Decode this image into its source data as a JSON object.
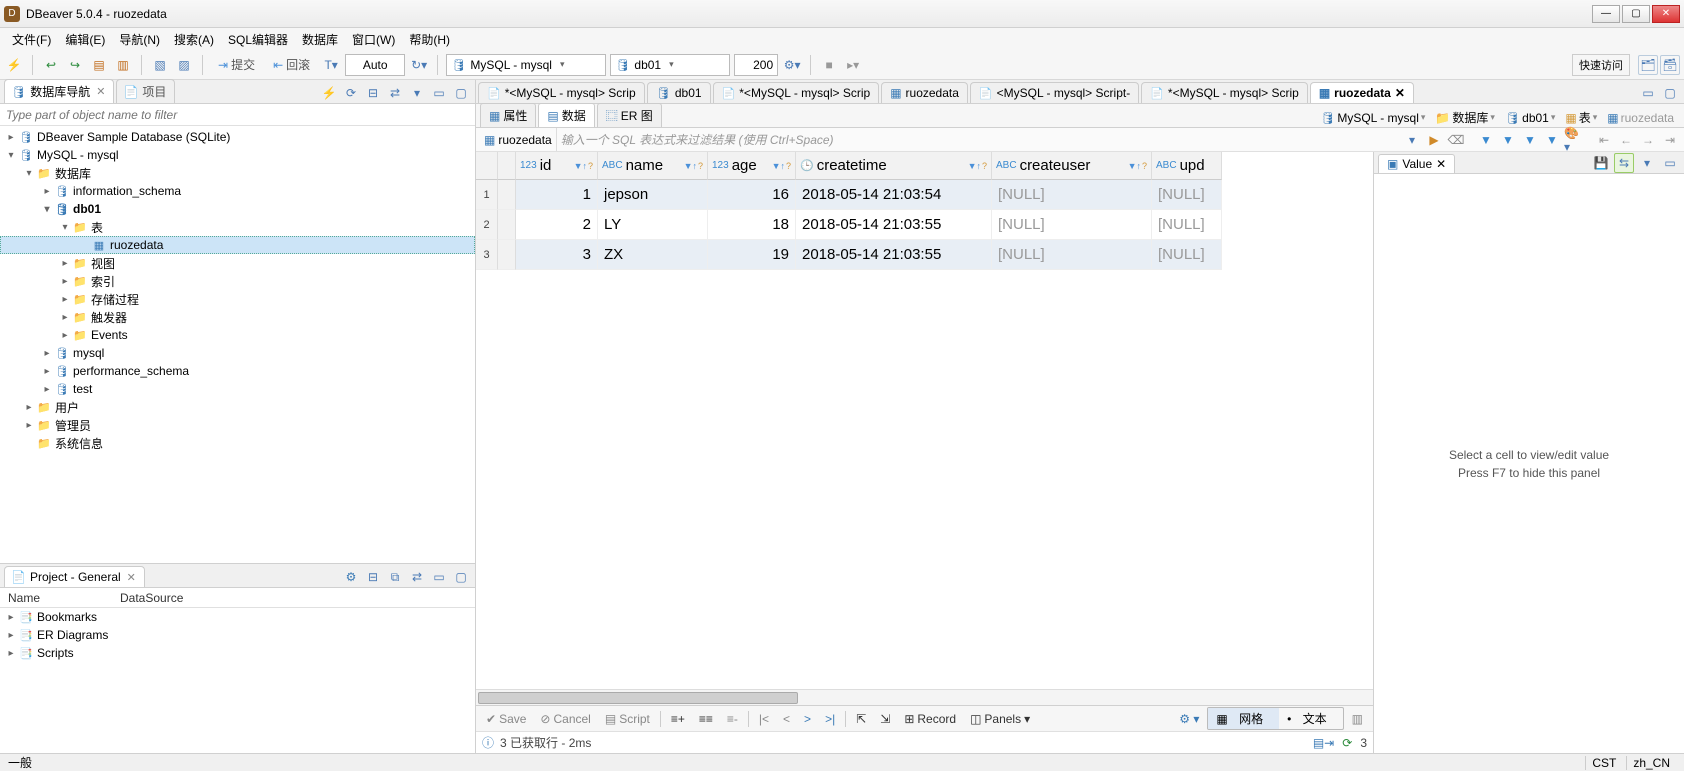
{
  "title": "DBeaver 5.0.4 - ruozedata",
  "menu": [
    "文件(F)",
    "编辑(E)",
    "导航(N)",
    "搜索(A)",
    "SQL编辑器",
    "数据库",
    "窗口(W)",
    "帮助(H)"
  ],
  "toolbar": {
    "commit": "提交",
    "rollback": "回滚",
    "auto": "Auto",
    "connection": "MySQL - mysql",
    "database": "db01",
    "limit": "200",
    "quick_access": "快速访问"
  },
  "nav_panel": {
    "tabs": [
      "数据库导航",
      "项目"
    ],
    "filter_placeholder": "Type part of object name to filter",
    "tree": {
      "root1": "DBeaver Sample Database (SQLite)",
      "root2": "MySQL - mysql",
      "db_group": "数据库",
      "dbs": {
        "information_schema": "information_schema",
        "db01": "db01",
        "mysql": "mysql",
        "performance_schema": "performance_schema",
        "test": "test"
      },
      "db01_children": {
        "tables": "表",
        "views": "视图",
        "indexes": "索引",
        "procs": "存储过程",
        "triggers": "触发器",
        "events": "Events"
      },
      "table_name": "ruozedata",
      "users": "用户",
      "admins": "管理员",
      "sysinfo": "系统信息"
    }
  },
  "project_panel": {
    "tab": "Project - General",
    "cols": [
      "Name",
      "DataSource"
    ],
    "items": [
      "Bookmarks",
      "ER Diagrams",
      "Scripts"
    ]
  },
  "editor_tabs": [
    {
      "label": "*<MySQL - mysql> Scrip",
      "active": false,
      "icon": "script"
    },
    {
      "label": "db01",
      "active": false,
      "icon": "db"
    },
    {
      "label": "*<MySQL - mysql> Scrip",
      "active": false,
      "icon": "script"
    },
    {
      "label": "ruozedata",
      "active": false,
      "icon": "table"
    },
    {
      "label": "<MySQL - mysql> Script-",
      "active": false,
      "icon": "script"
    },
    {
      "label": "*<MySQL - mysql> Scrip",
      "active": false,
      "icon": "script"
    },
    {
      "label": "ruozedata",
      "active": true,
      "icon": "table"
    }
  ],
  "subtabs": {
    "props": "属性",
    "data": "数据",
    "er": "ER 图"
  },
  "breadcrumbs": [
    {
      "icon": "conn",
      "label": "MySQL - mysql"
    },
    {
      "icon": "db",
      "label": "数据库"
    },
    {
      "icon": "dbitem",
      "label": "db01"
    },
    {
      "icon": "tables",
      "label": "表"
    },
    {
      "icon": "table",
      "label": "ruozedata"
    }
  ],
  "sql_filter": {
    "table": "ruozedata",
    "hint": "输入一个 SQL 表达式来过滤结果 (使用 Ctrl+Space)"
  },
  "grid": {
    "columns": [
      {
        "name": "id",
        "type": "123"
      },
      {
        "name": "name",
        "type": "ABC"
      },
      {
        "name": "age",
        "type": "123"
      },
      {
        "name": "createtime",
        "type": "clock"
      },
      {
        "name": "createuser",
        "type": "ABC"
      },
      {
        "name": "upd",
        "type": "ABC"
      }
    ],
    "rows": [
      {
        "id": "1",
        "name": "jepson",
        "age": "16",
        "createtime": "2018-05-14 21:03:54",
        "createuser": "[NULL]",
        "upd": "[NULL]"
      },
      {
        "id": "2",
        "name": "LY",
        "age": "18",
        "createtime": "2018-05-14 21:03:55",
        "createuser": "[NULL]",
        "upd": "[NULL]"
      },
      {
        "id": "3",
        "name": "ZX",
        "age": "19",
        "createtime": "2018-05-14 21:03:55",
        "createuser": "[NULL]",
        "upd": "[NULL]"
      }
    ]
  },
  "value_panel": {
    "tab": "Value",
    "msg1": "Select a cell to view/edit value",
    "msg2": "Press F7 to hide this panel"
  },
  "grid_actions": {
    "save": "Save",
    "cancel": "Cancel",
    "script": "Script",
    "record": "Record",
    "panels": "Panels",
    "grid": "网格",
    "text": "文本"
  },
  "exec_status": {
    "text": "3 已获取行 - 2ms",
    "refreshcount": "3"
  },
  "statusbar": {
    "left": "一般",
    "cst": "CST",
    "locale": "zh_CN"
  }
}
